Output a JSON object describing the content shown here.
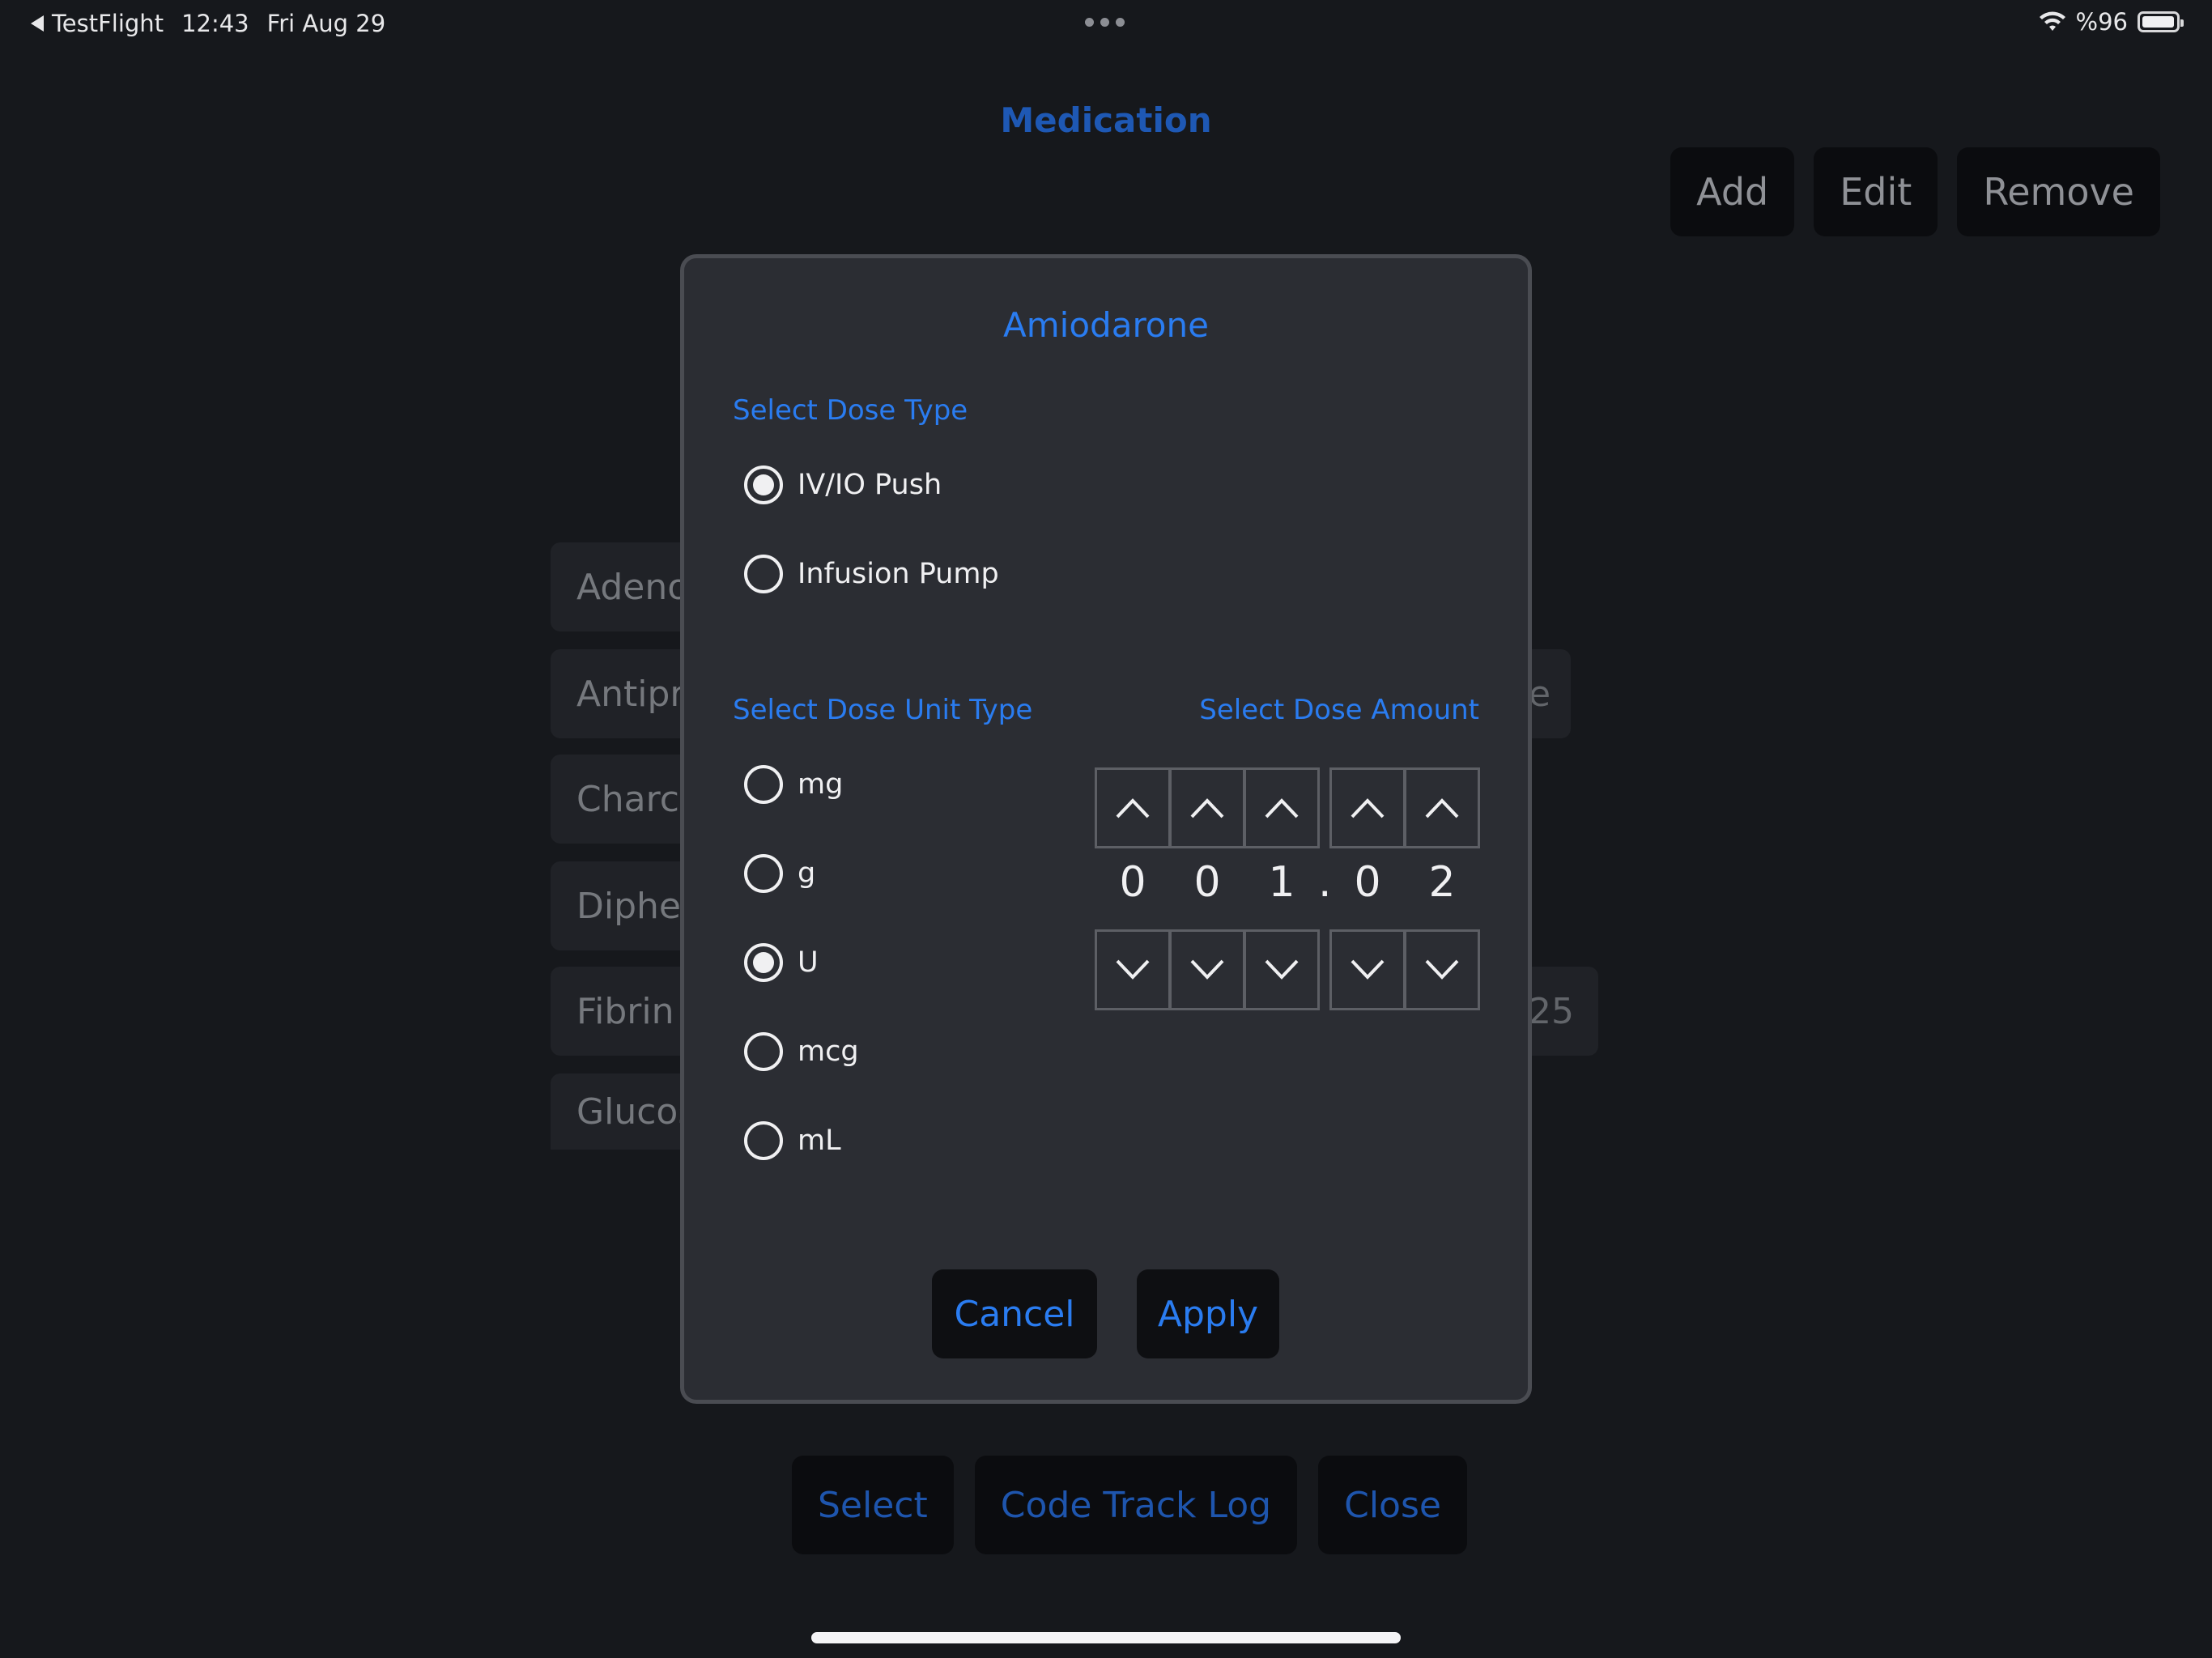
{
  "status_bar": {
    "back_app": "TestFlight",
    "time": "12:43",
    "date": "Fri Aug 29",
    "battery": "%96",
    "battery_level": 0.96
  },
  "page": {
    "title": "Medication",
    "top_buttons": {
      "add": "Add",
      "edit": "Edit",
      "remove": "Remove"
    },
    "list_items": [
      "Adeno",
      "Antipr",
      "Charc",
      "Diphe",
      "Fibrin",
      "Glucos"
    ],
    "right_fragments": [
      "e",
      "25"
    ],
    "bottom_buttons": {
      "select": "Select",
      "code_track_log": "Code Track Log",
      "close": "Close"
    }
  },
  "dialog": {
    "title": "Amiodarone",
    "dose_type_label": "Select Dose Type",
    "dose_types": [
      {
        "label": "IV/IO Push",
        "selected": true
      },
      {
        "label": "Infusion Pump",
        "selected": false
      }
    ],
    "unit_type_label": "Select Dose Unit Type",
    "units": [
      {
        "label": "mg",
        "selected": false
      },
      {
        "label": "g",
        "selected": false
      },
      {
        "label": "U",
        "selected": true
      },
      {
        "label": "mcg",
        "selected": false
      },
      {
        "label": "mL",
        "selected": false
      }
    ],
    "amount_label": "Select Dose Amount",
    "digits": [
      "0",
      "0",
      "1",
      "0",
      "2"
    ],
    "decimal": ".",
    "cancel": "Cancel",
    "apply": "Apply"
  }
}
